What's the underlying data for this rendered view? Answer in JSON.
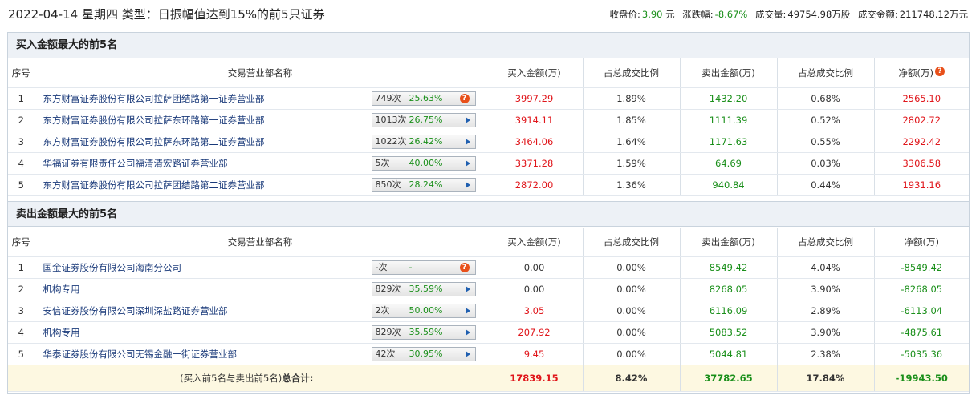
{
  "header": {
    "title": "2022-04-14 星期四 类型：日振幅值达到15%的前5只证券",
    "close_label": "收盘价:",
    "close_value": "3.90",
    "close_unit": "元",
    "change_label": "涨跌幅:",
    "change_value": "-8.67%",
    "volume_label": "成交量:",
    "volume_value": "49754.98万股",
    "amount_label": "成交金额:",
    "amount_value": "211748.12万元"
  },
  "columns": [
    "序号",
    "交易营业部名称",
    "买入金额(万)",
    "占总成交比例",
    "卖出金额(万)",
    "占总成交比例",
    "净额(万)"
  ],
  "buy": {
    "title": "买入金额最大的前5名",
    "rows": [
      {
        "no": "1",
        "name": "东方财富证券股份有限公司拉萨团结路第一证券营业部",
        "count": "749次",
        "pct": "25.63%",
        "icon": "question",
        "buy": "3997.29",
        "buy_ratio": "1.89%",
        "sell": "1432.20",
        "sell_ratio": "0.68%",
        "net": "2565.10",
        "net_color": "red"
      },
      {
        "no": "2",
        "name": "东方财富证券股份有限公司拉萨东环路第一证券营业部",
        "count": "1013次",
        "pct": "26.75%",
        "icon": "arrow",
        "buy": "3914.11",
        "buy_ratio": "1.85%",
        "sell": "1111.39",
        "sell_ratio": "0.52%",
        "net": "2802.72",
        "net_color": "red"
      },
      {
        "no": "3",
        "name": "东方财富证券股份有限公司拉萨东环路第二证券营业部",
        "count": "1022次",
        "pct": "26.42%",
        "icon": "arrow",
        "buy": "3464.06",
        "buy_ratio": "1.64%",
        "sell": "1171.63",
        "sell_ratio": "0.55%",
        "net": "2292.42",
        "net_color": "red"
      },
      {
        "no": "4",
        "name": "华福证券有限责任公司福清清宏路证券营业部",
        "count": "5次",
        "pct": "40.00%",
        "icon": "arrow",
        "buy": "3371.28",
        "buy_ratio": "1.59%",
        "sell": "64.69",
        "sell_ratio": "0.03%",
        "net": "3306.58",
        "net_color": "red"
      },
      {
        "no": "5",
        "name": "东方财富证券股份有限公司拉萨团结路第二证券营业部",
        "count": "850次",
        "pct": "28.24%",
        "icon": "arrow",
        "buy": "2872.00",
        "buy_ratio": "1.36%",
        "sell": "940.84",
        "sell_ratio": "0.44%",
        "net": "1931.16",
        "net_color": "red"
      }
    ]
  },
  "sell": {
    "title": "卖出金额最大的前5名",
    "rows": [
      {
        "no": "1",
        "name": "国金证券股份有限公司海南分公司",
        "count": "-次",
        "pct": "-",
        "icon": "question",
        "buy": "0.00",
        "buy_ratio": "0.00%",
        "sell": "8549.42",
        "sell_ratio": "4.04%",
        "net": "-8549.42",
        "net_color": "green",
        "buy_color": "plain"
      },
      {
        "no": "2",
        "name": "机构专用",
        "count": "829次",
        "pct": "35.59%",
        "icon": "arrow",
        "buy": "0.00",
        "buy_ratio": "0.00%",
        "sell": "8268.05",
        "sell_ratio": "3.90%",
        "net": "-8268.05",
        "net_color": "green",
        "buy_color": "plain"
      },
      {
        "no": "3",
        "name": "安信证券股份有限公司深圳深盐路证券营业部",
        "count": "2次",
        "pct": "50.00%",
        "icon": "arrow",
        "buy": "3.05",
        "buy_ratio": "0.00%",
        "sell": "6116.09",
        "sell_ratio": "2.89%",
        "net": "-6113.04",
        "net_color": "green",
        "buy_color": "red"
      },
      {
        "no": "4",
        "name": "机构专用",
        "count": "829次",
        "pct": "35.59%",
        "icon": "arrow",
        "buy": "207.92",
        "buy_ratio": "0.00%",
        "sell": "5083.52",
        "sell_ratio": "3.90%",
        "net": "-4875.61",
        "net_color": "green",
        "buy_color": "red"
      },
      {
        "no": "5",
        "name": "华泰证券股份有限公司无锡金融一街证券营业部",
        "count": "42次",
        "pct": "30.95%",
        "icon": "arrow",
        "buy": "9.45",
        "buy_ratio": "0.00%",
        "sell": "5044.81",
        "sell_ratio": "2.38%",
        "net": "-5035.36",
        "net_color": "green",
        "buy_color": "red"
      }
    ]
  },
  "total": {
    "label_prefix": "(买入前5名与卖出前5名)",
    "label_bold": "总合计:",
    "buy": "17839.15",
    "buy_ratio": "8.42%",
    "sell": "37782.65",
    "sell_ratio": "17.84%",
    "net": "-19943.50"
  },
  "colors": {
    "red": "#e0161b",
    "green": "#1a8f1a",
    "header_bg": "#edf1f6",
    "total_bg": "#fdf8e1"
  }
}
